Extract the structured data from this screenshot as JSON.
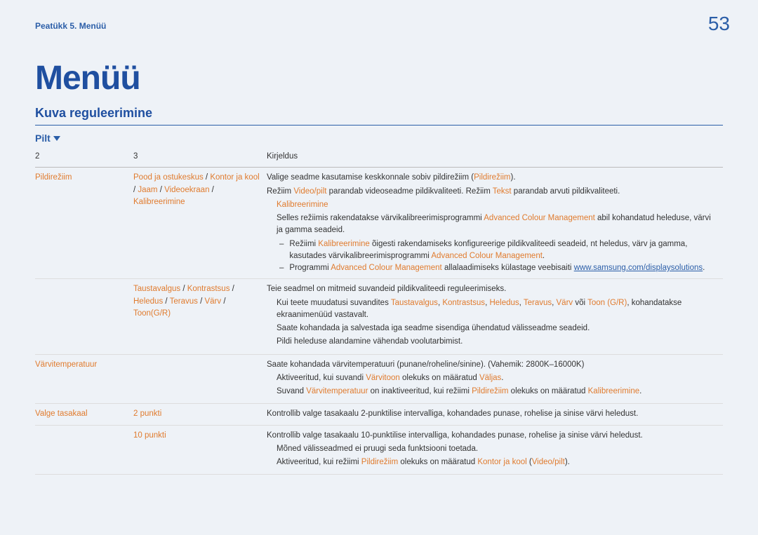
{
  "header": {
    "chapter": "Peatükk 5. Menüü",
    "page_number": "53"
  },
  "title": "Menüü",
  "subtitle": "Kuva reguleerimine",
  "section_tab": "Pilt",
  "table": {
    "headers": {
      "c1": "2",
      "c2": "3",
      "c3": "Kirjeldus"
    },
    "row1": {
      "c1": "Pildirežiim",
      "c2_parts": {
        "a": "Pood ja ostukeskus",
        "sep1": " / ",
        "b": "Kontor ja kool",
        "sep2": " / ",
        "c": "Jaam",
        "sep3": " / ",
        "d": "Videoekraan",
        "sep4": " / ",
        "e": "Kalibreerimine"
      },
      "l1a": "Valige seadme kasutamise keskkonnale sobiv pildirežiim (",
      "l1b": "Pildirežiim",
      "l1c": ").",
      "l2a": "Režiim ",
      "l2b": "Video/pilt",
      "l2c": " parandab videoseadme pildikvaliteeti. Režiim ",
      "l2d": "Tekst",
      "l2e": " parandab arvuti pildikvaliteeti.",
      "kal": "Kalibreerimine",
      "l3a": "Selles režiimis rakendatakse värvikalibreerimisprogrammi ",
      "l3b": "Advanced Colour Management",
      "l3c": " abil kohandatud heleduse, värvi ja gamma seadeid.",
      "d1a": "Režiimi ",
      "d1b": "Kalibreerimine",
      "d1c": " õigesti rakendamiseks konfigureerige pildikvaliteedi seadeid, nt heledus, värv ja gamma, kasutades värvikalibreerimisprogrammi ",
      "d1d": "Advanced Colour Management",
      "d1e": ".",
      "d2a": "Programmi ",
      "d2b": "Advanced Colour Management",
      "d2c": " allalaadimiseks külastage veebisaiti ",
      "d2d": "www.samsung.com/displaysolutions",
      "d2e": "."
    },
    "row2": {
      "c2_parts": {
        "a": "Taustavalgus",
        "sep1": " / ",
        "b": "Kontrastsus",
        "sep2": " / ",
        "c": "Heledus",
        "sep3": " / ",
        "d": "Teravus",
        "sep4": " / ",
        "e": "Värv",
        "sep5": " / ",
        "f": "Toon(G/R)"
      },
      "l1": "Teie seadmel on mitmeid suvandeid pildikvaliteedi reguleerimiseks.",
      "l2a": "Kui teete muudatusi suvandites ",
      "l2b": "Taustavalgus",
      "c1": ", ",
      "l2c": "Kontrastsus",
      "c2": ", ",
      "l2d": "Heledus",
      "c3": ", ",
      "l2e": "Teravus",
      "c4": ", ",
      "l2f": "Värv",
      "c5": " või ",
      "l2g": "Toon (G/R)",
      "l2h": ", kohandatakse ekraanimenüüd vastavalt.",
      "l3": "Saate kohandada ja salvestada iga seadme sisendiga ühendatud välisseadme seadeid.",
      "l4": "Pildi heleduse alandamine vähendab voolutarbimist."
    },
    "row3": {
      "c1": "Värvitemperatuur",
      "l1": "Saate kohandada värvitemperatuuri (punane/roheline/sinine). (Vahemik: 2800K–16000K)",
      "l2a": "Aktiveeritud, kui suvandi ",
      "l2b": "Värvitoon",
      "l2c": " olekuks on määratud ",
      "l2d": "Väljas",
      "l2e": ".",
      "l3a": "Suvand ",
      "l3b": "Värvitemperatuur",
      "l3c": " on inaktiveeritud, kui režiimi ",
      "l3d": "Pildirežiim",
      "l3e": " olekuks on määratud ",
      "l3f": "Kalibreerimine",
      "l3g": "."
    },
    "row4": {
      "c1": "Valge tasakaal",
      "c2a": "2 punkti",
      "l1": "Kontrollib valge tasakaalu 2-punktilise intervalliga, kohandades punase, rohelise ja sinise värvi heledust."
    },
    "row5": {
      "c2a": "10 punkti",
      "l1": "Kontrollib valge tasakaalu 10-punktilise intervalliga, kohandades punase, rohelise ja sinise värvi heledust.",
      "l2": "Mõned välisseadmed ei pruugi seda funktsiooni toetada.",
      "l3a": "Aktiveeritud, kui režiimi ",
      "l3b": "Pildirežiim",
      "l3c": " olekuks on määratud ",
      "l3d": "Kontor ja kool",
      "l3e": " (",
      "l3f": "Video/pilt",
      "l3g": ")."
    }
  }
}
